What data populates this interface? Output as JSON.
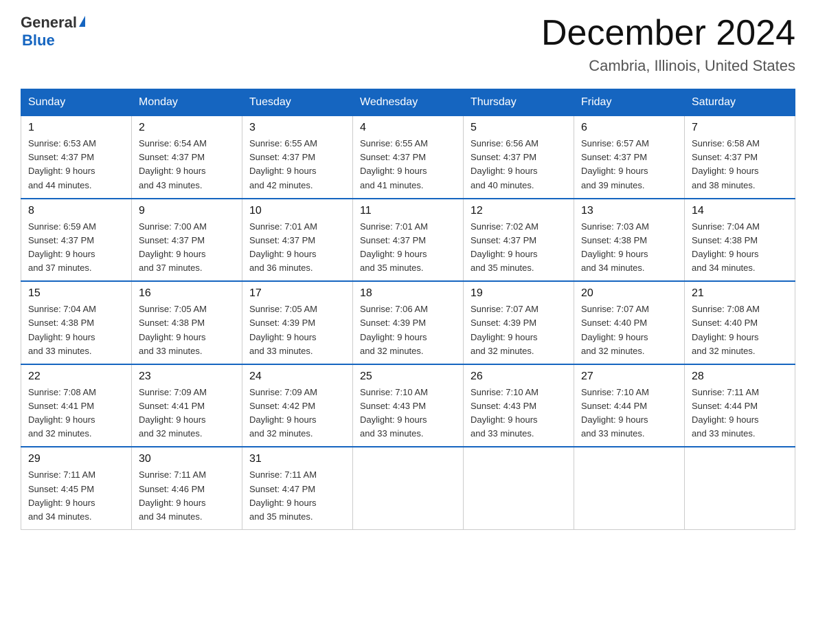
{
  "logo": {
    "general": "General",
    "arrow": "▶",
    "blue": "Blue"
  },
  "title": "December 2024",
  "subtitle": "Cambria, Illinois, United States",
  "weekdays": [
    "Sunday",
    "Monday",
    "Tuesday",
    "Wednesday",
    "Thursday",
    "Friday",
    "Saturday"
  ],
  "weeks": [
    [
      {
        "day": "1",
        "sunrise": "6:53 AM",
        "sunset": "4:37 PM",
        "daylight": "9 hours and 44 minutes."
      },
      {
        "day": "2",
        "sunrise": "6:54 AM",
        "sunset": "4:37 PM",
        "daylight": "9 hours and 43 minutes."
      },
      {
        "day": "3",
        "sunrise": "6:55 AM",
        "sunset": "4:37 PM",
        "daylight": "9 hours and 42 minutes."
      },
      {
        "day": "4",
        "sunrise": "6:55 AM",
        "sunset": "4:37 PM",
        "daylight": "9 hours and 41 minutes."
      },
      {
        "day": "5",
        "sunrise": "6:56 AM",
        "sunset": "4:37 PM",
        "daylight": "9 hours and 40 minutes."
      },
      {
        "day": "6",
        "sunrise": "6:57 AM",
        "sunset": "4:37 PM",
        "daylight": "9 hours and 39 minutes."
      },
      {
        "day": "7",
        "sunrise": "6:58 AM",
        "sunset": "4:37 PM",
        "daylight": "9 hours and 38 minutes."
      }
    ],
    [
      {
        "day": "8",
        "sunrise": "6:59 AM",
        "sunset": "4:37 PM",
        "daylight": "9 hours and 37 minutes."
      },
      {
        "day": "9",
        "sunrise": "7:00 AM",
        "sunset": "4:37 PM",
        "daylight": "9 hours and 37 minutes."
      },
      {
        "day": "10",
        "sunrise": "7:01 AM",
        "sunset": "4:37 PM",
        "daylight": "9 hours and 36 minutes."
      },
      {
        "day": "11",
        "sunrise": "7:01 AM",
        "sunset": "4:37 PM",
        "daylight": "9 hours and 35 minutes."
      },
      {
        "day": "12",
        "sunrise": "7:02 AM",
        "sunset": "4:37 PM",
        "daylight": "9 hours and 35 minutes."
      },
      {
        "day": "13",
        "sunrise": "7:03 AM",
        "sunset": "4:38 PM",
        "daylight": "9 hours and 34 minutes."
      },
      {
        "day": "14",
        "sunrise": "7:04 AM",
        "sunset": "4:38 PM",
        "daylight": "9 hours and 34 minutes."
      }
    ],
    [
      {
        "day": "15",
        "sunrise": "7:04 AM",
        "sunset": "4:38 PM",
        "daylight": "9 hours and 33 minutes."
      },
      {
        "day": "16",
        "sunrise": "7:05 AM",
        "sunset": "4:38 PM",
        "daylight": "9 hours and 33 minutes."
      },
      {
        "day": "17",
        "sunrise": "7:05 AM",
        "sunset": "4:39 PM",
        "daylight": "9 hours and 33 minutes."
      },
      {
        "day": "18",
        "sunrise": "7:06 AM",
        "sunset": "4:39 PM",
        "daylight": "9 hours and 32 minutes."
      },
      {
        "day": "19",
        "sunrise": "7:07 AM",
        "sunset": "4:39 PM",
        "daylight": "9 hours and 32 minutes."
      },
      {
        "day": "20",
        "sunrise": "7:07 AM",
        "sunset": "4:40 PM",
        "daylight": "9 hours and 32 minutes."
      },
      {
        "day": "21",
        "sunrise": "7:08 AM",
        "sunset": "4:40 PM",
        "daylight": "9 hours and 32 minutes."
      }
    ],
    [
      {
        "day": "22",
        "sunrise": "7:08 AM",
        "sunset": "4:41 PM",
        "daylight": "9 hours and 32 minutes."
      },
      {
        "day": "23",
        "sunrise": "7:09 AM",
        "sunset": "4:41 PM",
        "daylight": "9 hours and 32 minutes."
      },
      {
        "day": "24",
        "sunrise": "7:09 AM",
        "sunset": "4:42 PM",
        "daylight": "9 hours and 32 minutes."
      },
      {
        "day": "25",
        "sunrise": "7:10 AM",
        "sunset": "4:43 PM",
        "daylight": "9 hours and 33 minutes."
      },
      {
        "day": "26",
        "sunrise": "7:10 AM",
        "sunset": "4:43 PM",
        "daylight": "9 hours and 33 minutes."
      },
      {
        "day": "27",
        "sunrise": "7:10 AM",
        "sunset": "4:44 PM",
        "daylight": "9 hours and 33 minutes."
      },
      {
        "day": "28",
        "sunrise": "7:11 AM",
        "sunset": "4:44 PM",
        "daylight": "9 hours and 33 minutes."
      }
    ],
    [
      {
        "day": "29",
        "sunrise": "7:11 AM",
        "sunset": "4:45 PM",
        "daylight": "9 hours and 34 minutes."
      },
      {
        "day": "30",
        "sunrise": "7:11 AM",
        "sunset": "4:46 PM",
        "daylight": "9 hours and 34 minutes."
      },
      {
        "day": "31",
        "sunrise": "7:11 AM",
        "sunset": "4:47 PM",
        "daylight": "9 hours and 35 minutes."
      },
      null,
      null,
      null,
      null
    ]
  ],
  "labels": {
    "sunrise": "Sunrise:",
    "sunset": "Sunset:",
    "daylight": "Daylight:"
  }
}
